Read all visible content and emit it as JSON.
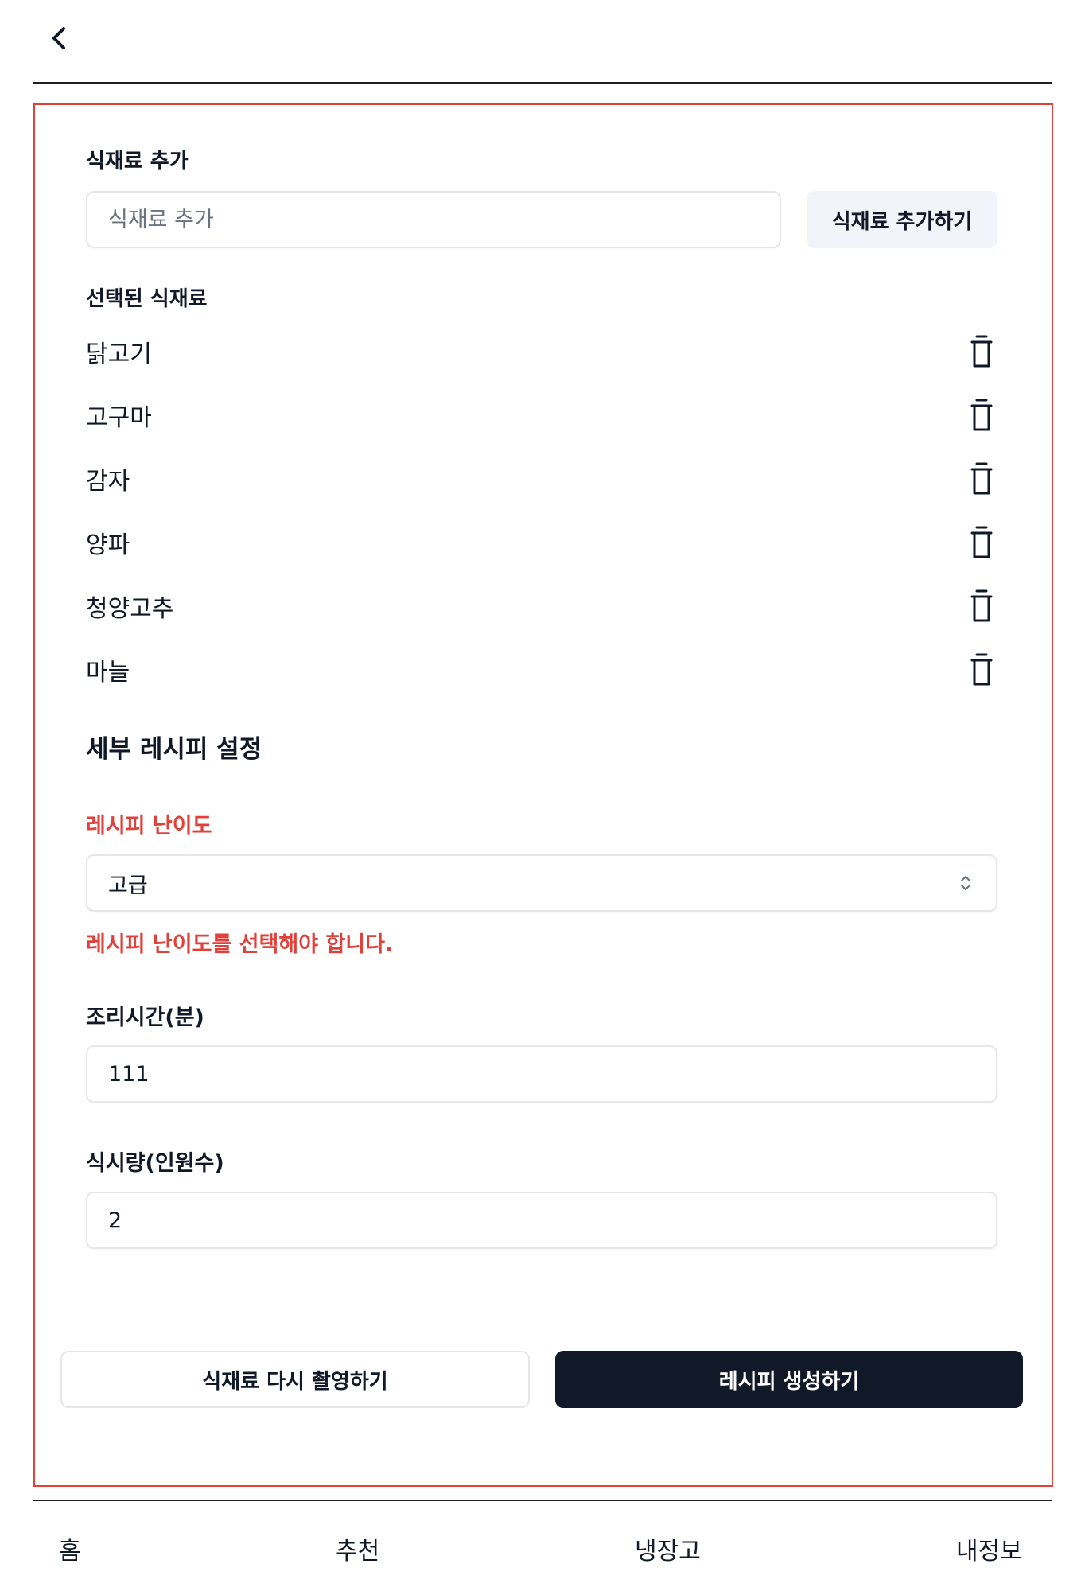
{
  "ingredient_add": {
    "label": "식재료 추가",
    "placeholder": "식재료 추가",
    "button_label": "식재료 추가하기"
  },
  "selected": {
    "label": "선택된 식재료",
    "items": [
      "닭고기",
      "고구마",
      "감자",
      "양파",
      "청양고추",
      "마늘"
    ]
  },
  "details": {
    "title": "세부 레시피 설정",
    "difficulty_label": "레시피 난이도",
    "difficulty_value": "고급",
    "difficulty_error": "레시피 난이도를 선택해야 합니다.",
    "time_label": "조리시간(분)",
    "time_value": "111",
    "servings_label": "식시량(인원수)",
    "servings_value": "2"
  },
  "actions": {
    "retake_label": "식재료 다시 촬영하기",
    "generate_label": "레시피 생성하기"
  },
  "nav": {
    "home": "홈",
    "recommend": "추천",
    "fridge": "냉장고",
    "profile": "내정보"
  },
  "colors": {
    "accent_error": "#e0413a",
    "primary_dark": "#111827"
  }
}
